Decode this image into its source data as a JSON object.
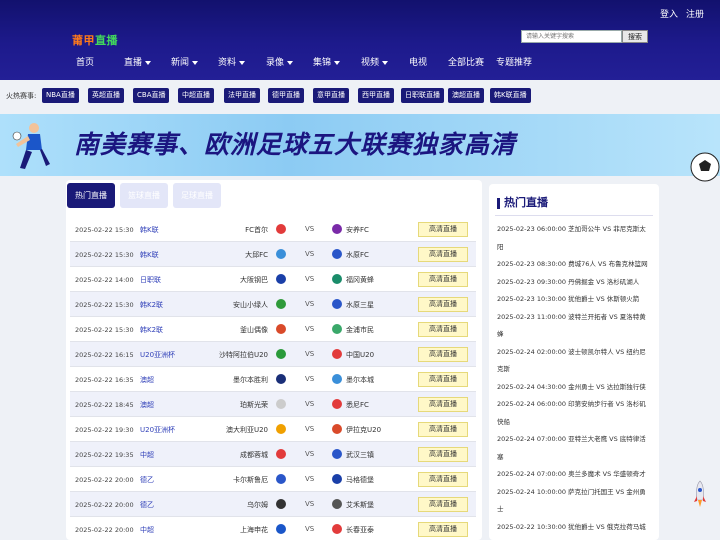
{
  "header": {
    "login": "登入",
    "register": "注册",
    "logo_part1": "莆甲",
    "logo_part2": "直播",
    "search_placeholder": "请输入关键字搜索",
    "search_button": "搜索"
  },
  "nav": [
    {
      "label": "首页",
      "dropdown": false
    },
    {
      "label": "直播",
      "dropdown": true
    },
    {
      "label": "新闻",
      "dropdown": true
    },
    {
      "label": "资料",
      "dropdown": true
    },
    {
      "label": "录像",
      "dropdown": true
    },
    {
      "label": "集锦",
      "dropdown": true
    },
    {
      "label": "视频",
      "dropdown": true
    },
    {
      "label": "电视",
      "dropdown": false
    },
    {
      "label": "全部比赛",
      "dropdown": false
    },
    {
      "label": "专题推荐",
      "dropdown": false
    }
  ],
  "hot_bar": {
    "label": "火热赛事:",
    "tags": [
      "NBA直播",
      "英超直播",
      "CBA直播",
      "中超直播",
      "法甲直播",
      "德甲直播",
      "意甲直播",
      "西甲直播",
      "日职联直播",
      "澳超直播",
      "韩K联直播"
    ]
  },
  "banner": {
    "text": "南美赛事、欧洲足球五大联赛独家高清"
  },
  "tabs": [
    "热门直播",
    "篮球直播",
    "足球直播"
  ],
  "matches": [
    {
      "time": "2025-02-22 15:30",
      "league": "韩K联",
      "home": "FC首尔",
      "away": "安养FC",
      "btn": "高清直播"
    },
    {
      "time": "2025-02-22 15:30",
      "league": "韩K联",
      "home": "大邱FC",
      "away": "水原FC",
      "btn": "高清直播"
    },
    {
      "time": "2025-02-22 14:00",
      "league": "日职联",
      "home": "大阪钢巴",
      "away": "福冈黄蜂",
      "btn": "高清直播"
    },
    {
      "time": "2025-02-22 15:30",
      "league": "韩K2联",
      "home": "安山小绿人",
      "away": "水原三星",
      "btn": "高清直播"
    },
    {
      "time": "2025-02-22 15:30",
      "league": "韩K2联",
      "home": "釜山偶像",
      "away": "金浦市民",
      "btn": "高清直播"
    },
    {
      "time": "2025-02-22 16:15",
      "league": "U20亚洲杯",
      "home": "沙特阿拉伯U20",
      "away": "中国U20",
      "btn": "高清直播"
    },
    {
      "time": "2025-02-22 16:35",
      "league": "澳超",
      "home": "墨尔本胜利",
      "away": "墨尔本城",
      "btn": "高清直播"
    },
    {
      "time": "2025-02-22 18:45",
      "league": "澳超",
      "home": "珀斯光荣",
      "away": "悉尼FC",
      "btn": "高清直播"
    },
    {
      "time": "2025-02-22 19:30",
      "league": "U20亚洲杯",
      "home": "澳大利亚U20",
      "away": "伊拉克U20",
      "btn": "高清直播"
    },
    {
      "time": "2025-02-22 19:35",
      "league": "中超",
      "home": "成都蓉城",
      "away": "武汉三镇",
      "btn": "高清直播"
    },
    {
      "time": "2025-02-22 20:00",
      "league": "德乙",
      "home": "卡尔斯鲁厄",
      "away": "马格德堡",
      "btn": "高清直播"
    },
    {
      "time": "2025-02-22 20:00",
      "league": "德乙",
      "home": "乌尔姆",
      "away": "艾禾斯堡",
      "btn": "高清直播"
    },
    {
      "time": "2025-02-22 20:00",
      "league": "中超",
      "home": "上海申花",
      "away": "长春亚泰",
      "btn": "高清直播"
    }
  ],
  "sidebar": {
    "title": "热门直播",
    "lines": [
      "2025-02-23 06:00:00   芝加哥公牛  VS  菲尼克斯太",
      "阳",
      "2025-02-23 08:30:00   费城76人  VS  布鲁克林篮网",
      "2025-02-23 09:30:00   丹佛掘金  VS  洛杉矶湖人",
      "2025-02-23 10:30:00   犹他爵士  VS  休斯顿火箭",
      "2025-02-23 11:00:00   波特兰开拓者  VS  夏洛特黄",
      "蜂",
      "2025-02-24 02:00:00   波士顿凯尔特人  VS  纽约尼",
      "克斯",
      "2025-02-24 04:30:00   金州勇士  VS  达拉斯独行侠",
      "2025-02-24 06:00:00   印第安纳步行者  VS  洛杉矶",
      "快船",
      "2025-02-24 07:00:00   亚特兰大老鹰  VS  底特律活",
      "塞",
      "2025-02-24 07:00:00   奥兰多魔术  VS  华盛顿奇才",
      "2025-02-24 10:00:00   萨克拉门托国王  VS  金州勇",
      "士",
      "2025-02-22 10:30:00   犹他爵士  VS  俄克拉荷马城",
      "雷霆"
    ]
  },
  "colors": {
    "header_bg": "#1d1a8c",
    "accent": "#1a1a78",
    "button_bg": "#fff8c8",
    "league_text": "#2f3fb8"
  }
}
